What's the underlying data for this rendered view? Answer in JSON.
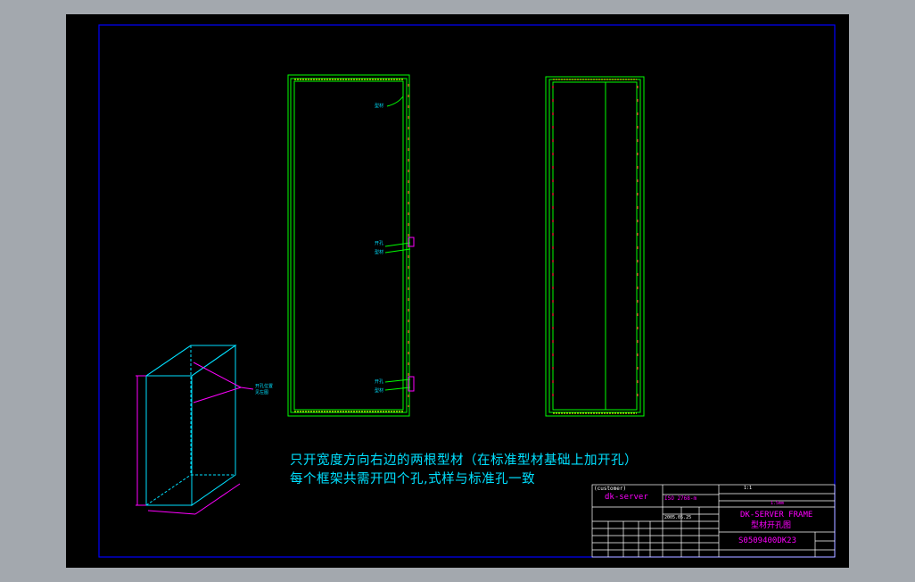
{
  "notes": {
    "line1": "只开宽度方向右边的两根型材（在标准型材基础上加开孔）",
    "line2": "每个框架共需开四个孔,式样与标准孔一致"
  },
  "title_block": {
    "company_header": "(customer)",
    "company": "dk-server",
    "std_label": "ISO 2768-m",
    "title_en": "DK-SERVER  FRAME",
    "title_cn": "型材开孔图",
    "drawing_no": "S0509400DK23",
    "date": "2005.05.25",
    "scale": "1:1",
    "thickness": "1.5mm"
  },
  "colors": {
    "frame": "#00ff00",
    "border": "#0000ff",
    "iso_view": "#00e0ff",
    "dimension": "#ff00ff",
    "text": "#00e0ff"
  }
}
